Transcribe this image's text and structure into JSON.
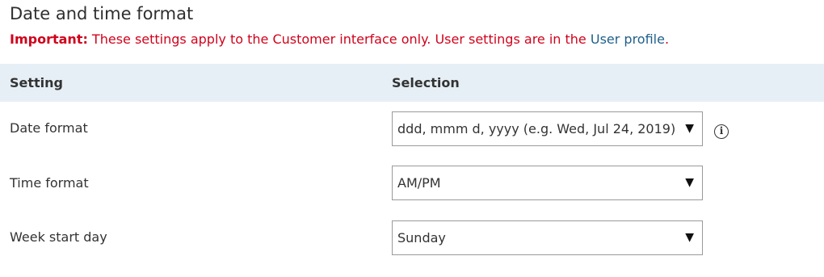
{
  "page": {
    "title": "Date and time format"
  },
  "notice": {
    "label": "Important:",
    "text": " These settings apply to the Customer interface only. User settings are in the ",
    "link_text": "User profile",
    "suffix": "."
  },
  "table": {
    "headers": {
      "setting": "Setting",
      "selection": "Selection"
    },
    "rows": [
      {
        "label": "Date format",
        "value": "ddd, mmm d, yyyy (e.g. Wed, Jul 24, 2019)",
        "caret": "▼"
      },
      {
        "label": "Time format",
        "value": "AM/PM",
        "caret": "▼"
      },
      {
        "label": "Week start day",
        "value": "Sunday",
        "caret": "▼"
      }
    ]
  },
  "icons": {
    "info": "i"
  },
  "colors": {
    "important": "#d0021b",
    "link": "#1f5f8b",
    "header_bg": "#e7eff6"
  }
}
